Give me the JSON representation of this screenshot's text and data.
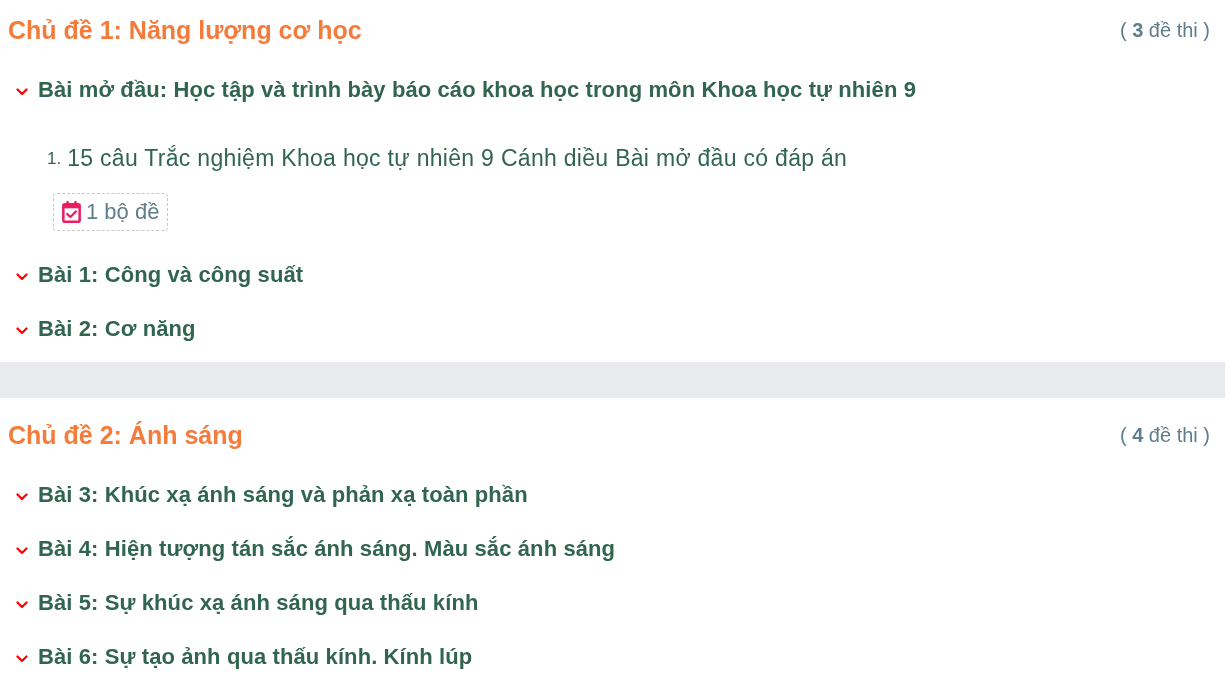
{
  "sections": [
    {
      "title": "Chủ đề 1: Năng lượng cơ học",
      "count": "( **3** đề thi )",
      "lessons": [
        {
          "title": "Bài mở đầu: Học tập và trình bày báo cáo khoa học trong môn Khoa học tự nhiên 9",
          "tests": [
            {
              "number": "1.",
              "title": "15 câu Trắc nghiệm Khoa học tự nhiên 9 Cánh diều Bài mở đầu có đáp án",
              "sets": "1 bộ đề"
            }
          ]
        },
        {
          "title": "Bài 1: Công và công suất"
        },
        {
          "title": "Bài 2: Cơ năng"
        }
      ]
    },
    {
      "title": "Chủ đề 2: Ánh sáng",
      "count": "( **4** đề thi )",
      "lessons": [
        {
          "title": "Bài 3: Khúc xạ ánh sáng và phản xạ toàn phần"
        },
        {
          "title": "Bài 4: Hiện tượng tán sắc ánh sáng. Màu sắc ánh sáng"
        },
        {
          "title": "Bài 5: Sự khúc xạ ánh sáng qua thấu kính"
        },
        {
          "title": "Bài 6: Sự tạo ảnh qua thấu kính. Kính lúp"
        }
      ]
    }
  ]
}
